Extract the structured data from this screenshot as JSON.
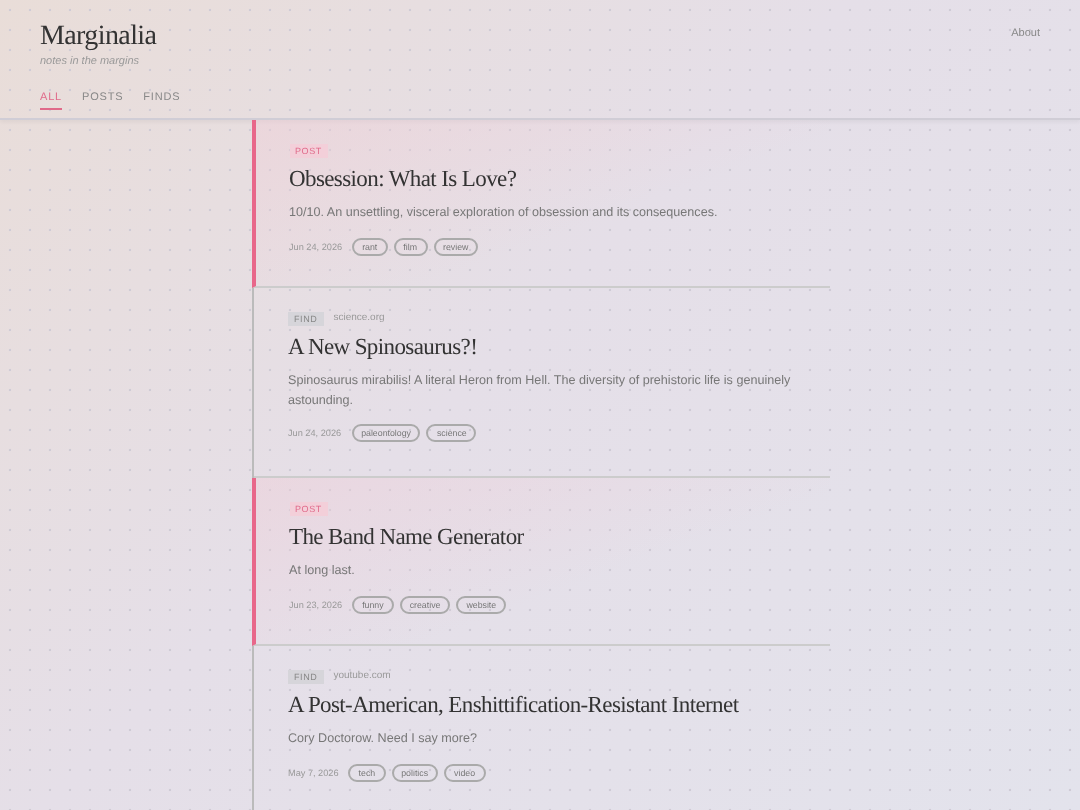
{
  "site": {
    "title": "Marginalia",
    "tagline": "notes in the margins"
  },
  "nav": {
    "about": "About"
  },
  "tabs": [
    {
      "label": "ALL",
      "selected": true
    },
    {
      "label": "POSTS",
      "selected": false
    },
    {
      "label": "FINDS",
      "selected": false
    }
  ],
  "entries": [
    {
      "kind": "post",
      "badge": "POST",
      "title": "Obsession: What Is Love?",
      "summary": "10/10. An unsettling, visceral exploration of obsession and its consequences.",
      "date": "Jun 24, 2026",
      "tags": [
        "rant",
        "film",
        "review"
      ]
    },
    {
      "kind": "find",
      "badge": "FIND",
      "source": "science.org",
      "title": "A New Spinosaurus?!",
      "summary": "Spinosaurus mirabilis! A literal Heron from Hell. The diversity of prehistoric life is genuinely astounding.",
      "date": "Jun 24, 2026",
      "tags": [
        "paleontology",
        "science"
      ]
    },
    {
      "kind": "post",
      "badge": "POST",
      "title": "The Band Name Generator",
      "summary": "At long last.",
      "date": "Jun 23, 2026",
      "tags": [
        "funny",
        "creative",
        "website"
      ]
    },
    {
      "kind": "find",
      "badge": "FIND",
      "source": "youtube.com",
      "title": "A Post-American, Enshittification-Resistant Internet",
      "summary": "Cory Doctorow. Need I say more?",
      "date": "May 7, 2026",
      "tags": [
        "tech",
        "politics",
        "video"
      ]
    }
  ]
}
